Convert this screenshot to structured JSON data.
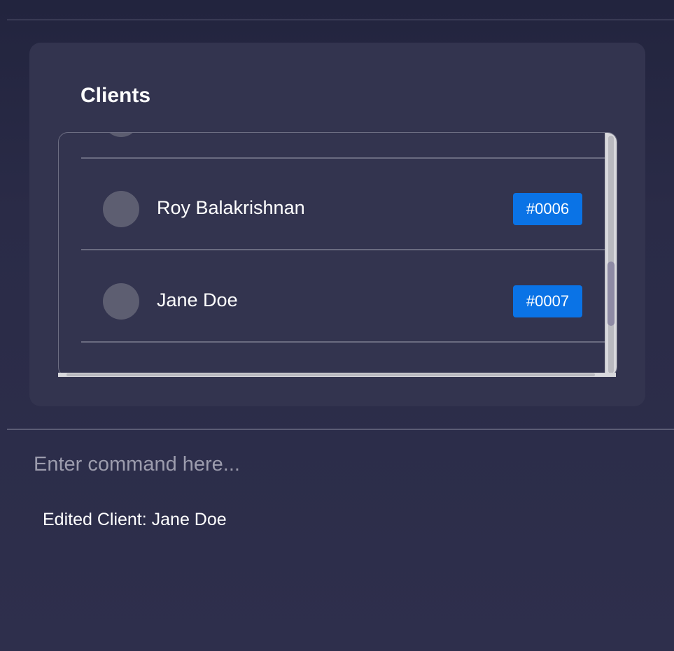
{
  "clients_panel": {
    "title": "Clients",
    "clients": [
      {
        "name": "Roy Balakrishnan",
        "id": "#0006"
      },
      {
        "name": "Jane Doe",
        "id": "#0007"
      }
    ]
  },
  "command_box": {
    "placeholder": "Enter command here...",
    "value": ""
  },
  "result_display": {
    "message": "Edited Client: Jane Doe"
  },
  "colors": {
    "background": "#2a2b47",
    "card": "#33344f",
    "id_badge": "#0a73e6",
    "avatar": "#5d5e71"
  },
  "icons": {
    "avatar": "avatar-icon"
  }
}
